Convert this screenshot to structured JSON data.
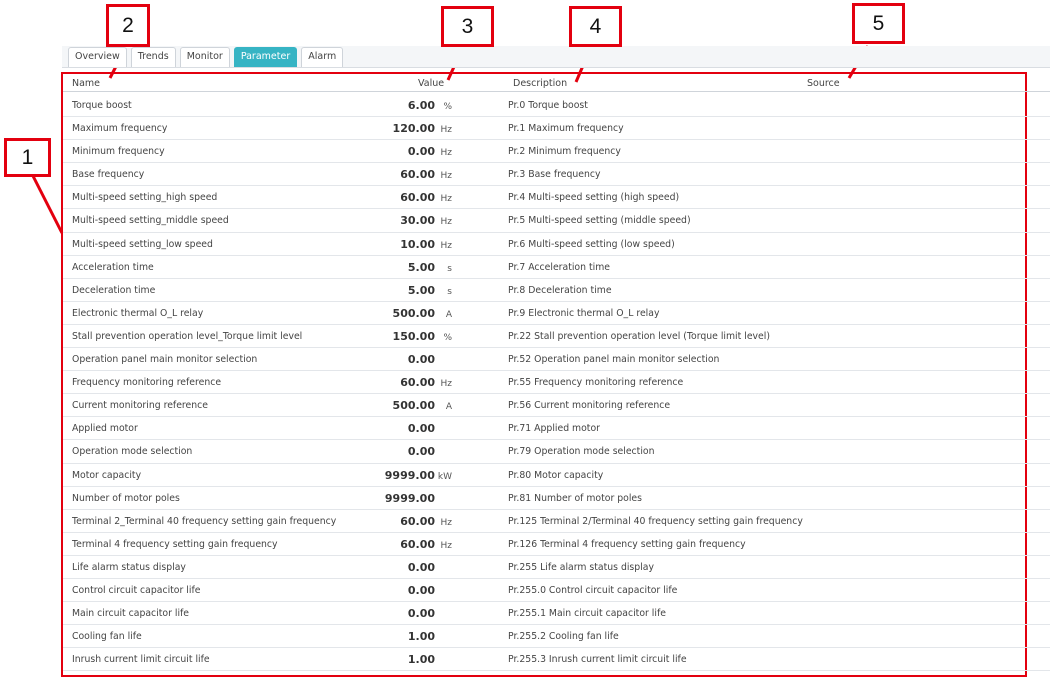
{
  "callouts": [
    "1",
    "2",
    "3",
    "4",
    "5"
  ],
  "tabs": [
    {
      "label": "Overview",
      "active": false
    },
    {
      "label": "Trends",
      "active": false
    },
    {
      "label": "Monitor",
      "active": false
    },
    {
      "label": "Parameter",
      "active": true
    },
    {
      "label": "Alarm",
      "active": false
    }
  ],
  "columns": {
    "name": "Name",
    "value": "Value",
    "description": "Description",
    "source": "Source"
  },
  "rows": [
    {
      "name": "Torque boost",
      "value": "6.00",
      "unit": "%",
      "description": "Pr.0 Torque boost"
    },
    {
      "name": "Maximum frequency",
      "value": "120.00",
      "unit": "Hz",
      "description": "Pr.1 Maximum frequency"
    },
    {
      "name": "Minimum frequency",
      "value": "0.00",
      "unit": "Hz",
      "description": "Pr.2 Minimum frequency"
    },
    {
      "name": "Base frequency",
      "value": "60.00",
      "unit": "Hz",
      "description": "Pr.3 Base frequency"
    },
    {
      "name": "Multi-speed setting_high speed",
      "value": "60.00",
      "unit": "Hz",
      "description": "Pr.4 Multi-speed setting (high speed)"
    },
    {
      "name": "Multi-speed setting_middle speed",
      "value": "30.00",
      "unit": "Hz",
      "description": "Pr.5 Multi-speed setting (middle speed)"
    },
    {
      "name": "Multi-speed setting_low speed",
      "value": "10.00",
      "unit": "Hz",
      "description": "Pr.6 Multi-speed setting (low speed)"
    },
    {
      "name": "Acceleration time",
      "value": "5.00",
      "unit": "s",
      "description": "Pr.7 Acceleration time"
    },
    {
      "name": "Deceleration time",
      "value": "5.00",
      "unit": "s",
      "description": "Pr.8 Deceleration time"
    },
    {
      "name": "Electronic thermal O_L relay",
      "value": "500.00",
      "unit": "A",
      "description": "Pr.9 Electronic thermal O_L relay"
    },
    {
      "name": "Stall prevention operation level_Torque limit level",
      "value": "150.00",
      "unit": "%",
      "description": "Pr.22 Stall prevention operation level (Torque limit level)"
    },
    {
      "name": "Operation panel main monitor selection",
      "value": "0.00",
      "unit": "",
      "description": "Pr.52 Operation panel main monitor selection"
    },
    {
      "name": "Frequency monitoring reference",
      "value": "60.00",
      "unit": "Hz",
      "description": "Pr.55 Frequency monitoring reference"
    },
    {
      "name": "Current monitoring reference",
      "value": "500.00",
      "unit": "A",
      "description": "Pr.56 Current monitoring reference"
    },
    {
      "name": "Applied motor",
      "value": "0.00",
      "unit": "",
      "description": "Pr.71 Applied motor"
    },
    {
      "name": "Operation mode selection",
      "value": "0.00",
      "unit": "",
      "description": "Pr.79 Operation mode selection"
    },
    {
      "name": "Motor capacity",
      "value": "9999.00",
      "unit": "kW",
      "description": "Pr.80 Motor capacity"
    },
    {
      "name": "Number of motor poles",
      "value": "9999.00",
      "unit": "",
      "description": "Pr.81 Number of motor poles"
    },
    {
      "name": "Terminal 2_Terminal 40 frequency setting gain frequency",
      "value": "60.00",
      "unit": "Hz",
      "description": "Pr.125 Terminal 2/Terminal 40 frequency setting gain frequency"
    },
    {
      "name": "Terminal 4 frequency setting gain frequency",
      "value": "60.00",
      "unit": "Hz",
      "description": "Pr.126 Terminal 4 frequency setting gain frequency"
    },
    {
      "name": "Life alarm status display",
      "value": "0.00",
      "unit": "",
      "description": "Pr.255 Life alarm status display"
    },
    {
      "name": "Control circuit capacitor life",
      "value": "0.00",
      "unit": "",
      "description": "Pr.255.0 Control circuit capacitor life"
    },
    {
      "name": "Main circuit capacitor life",
      "value": "0.00",
      "unit": "",
      "description": "Pr.255.1 Main circuit capacitor life"
    },
    {
      "name": "Cooling fan life",
      "value": "1.00",
      "unit": "",
      "description": "Pr.255.2 Cooling fan life"
    },
    {
      "name": "Inrush current limit circuit life",
      "value": "1.00",
      "unit": "",
      "description": "Pr.255.3 Inrush current limit circuit life"
    }
  ],
  "colors": {
    "accent": "#36b4c4",
    "callout_red": "#e3000f"
  }
}
